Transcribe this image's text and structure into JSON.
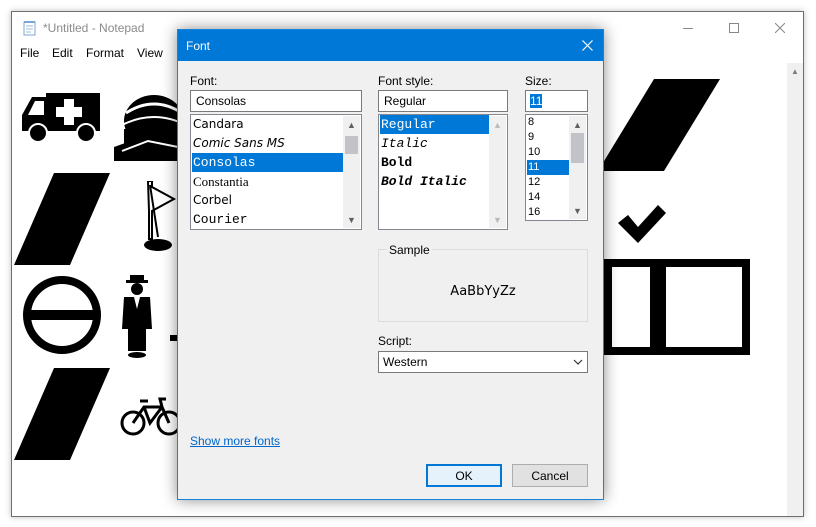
{
  "notepad": {
    "title": "*Untitled - Notepad",
    "menu": [
      "File",
      "Edit",
      "Format",
      "View"
    ],
    "icons": {
      "app": "notepad-icon",
      "minimize": "minimize-icon",
      "maximize": "maximize-icon",
      "close": "close-icon",
      "content_symbols": [
        "ambulance-icon",
        "steam-locomotive-icon",
        "slash-icon",
        "flag-icon",
        "no-entry-icon",
        "man-in-suit-icon",
        "bicycle-icon",
        "checkmark-icon",
        "empty-box-icon"
      ]
    }
  },
  "dialog": {
    "title": "Font",
    "font_label": "Font:",
    "font_value": "Consolas",
    "font_list": [
      "Candara",
      "Comic Sans MS",
      "Consolas",
      "Constantia",
      "Corbel",
      "Courier"
    ],
    "font_selected": "Consolas",
    "style_label": "Font style:",
    "style_value": "Regular",
    "style_list": [
      "Regular",
      "Italic",
      "Bold",
      "Bold Italic"
    ],
    "style_selected": "Regular",
    "size_label": "Size:",
    "size_value": "11",
    "size_list": [
      "8",
      "9",
      "10",
      "11",
      "12",
      "14",
      "16"
    ],
    "size_selected": "11",
    "sample_label": "Sample",
    "sample_text": "AaBbYyZz",
    "script_label": "Script:",
    "script_value": "Western",
    "show_more": "Show more fonts",
    "ok": "OK",
    "cancel": "Cancel"
  },
  "colors": {
    "accent": "#0078d7",
    "link": "#0066cc",
    "dialog_bg": "#f0f0f0"
  }
}
